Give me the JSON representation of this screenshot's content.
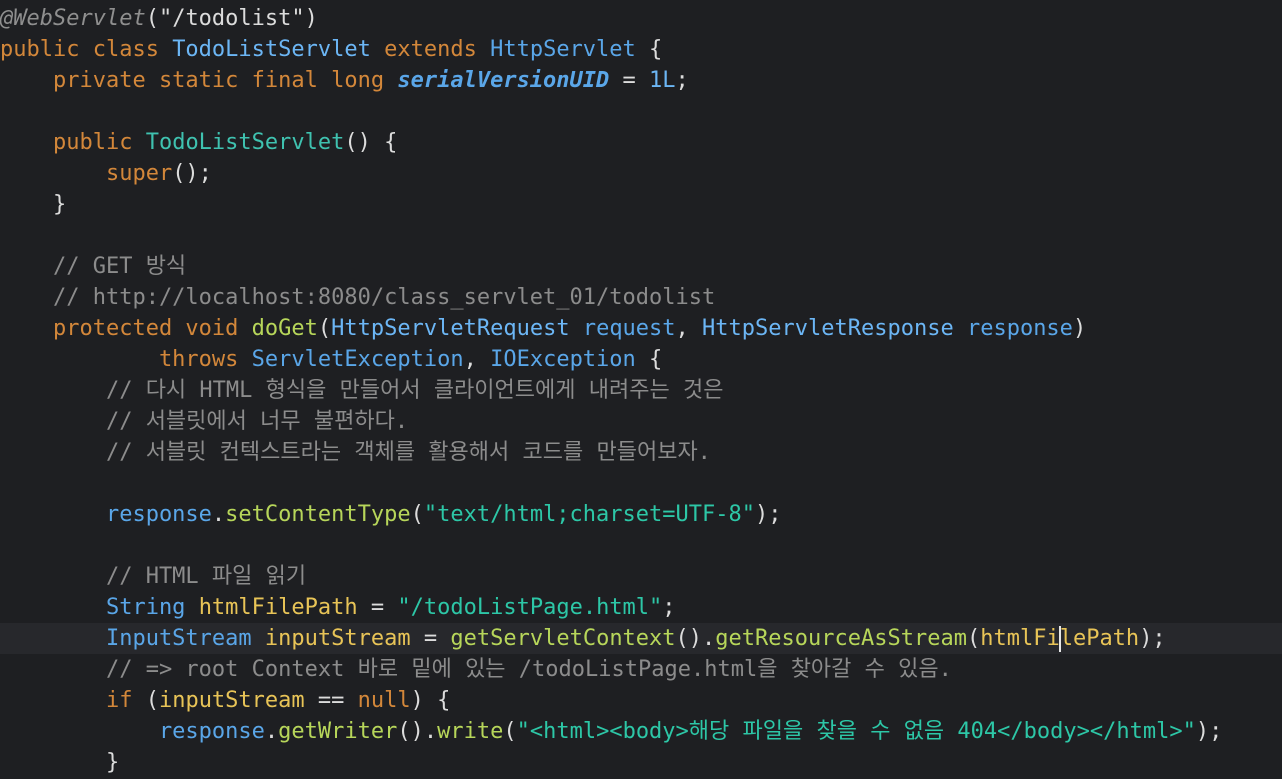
{
  "editor": {
    "caret_line": 20,
    "lines": [
      [
        [
          "@WebServlet",
          "ann"
        ],
        [
          "(\"/todolist\")",
          "def"
        ]
      ],
      [
        [
          "public class ",
          "kw"
        ],
        [
          "TodoListServlet",
          "cls"
        ],
        [
          " extends ",
          "kw"
        ],
        [
          "HttpServlet",
          "type"
        ],
        [
          " {",
          "def"
        ]
      ],
      [
        [
          "    private static final long ",
          "kw"
        ],
        [
          "serialVersionUID",
          "field"
        ],
        [
          " = ",
          "def"
        ],
        [
          "1L",
          "num"
        ],
        [
          ";",
          "def"
        ]
      ],
      [],
      [
        [
          "    public ",
          "kw"
        ],
        [
          "TodoListServlet",
          "ctor"
        ],
        [
          "() {",
          "def"
        ]
      ],
      [
        [
          "        super",
          "kw"
        ],
        [
          "();",
          "def"
        ]
      ],
      [
        [
          "    }",
          "def"
        ]
      ],
      [],
      [
        [
          "    // GET 방식",
          "cmt"
        ]
      ],
      [
        [
          "    // http://localhost:8080/class_servlet_01/todolist",
          "cmt"
        ]
      ],
      [
        [
          "    protected void ",
          "kw"
        ],
        [
          "doGet",
          "fn"
        ],
        [
          "(",
          "def"
        ],
        [
          "HttpServletRequest",
          "cls"
        ],
        [
          " request",
          "type"
        ],
        [
          ", ",
          "def"
        ],
        [
          "HttpServletResponse",
          "cls"
        ],
        [
          " response",
          "type"
        ],
        [
          ")",
          "def"
        ]
      ],
      [
        [
          "            throws ",
          "kw"
        ],
        [
          "ServletException",
          "type"
        ],
        [
          ", ",
          "def"
        ],
        [
          "IOException",
          "type"
        ],
        [
          " {",
          "def"
        ]
      ],
      [
        [
          "        // 다시 HTML 형식을 만들어서 클라이언트에게 내려주는 것은",
          "cmt"
        ]
      ],
      [
        [
          "        // 서블릿에서 너무 불편하다.",
          "cmt"
        ]
      ],
      [
        [
          "        // 서블릿 컨텍스트라는 객체를 활용해서 코드를 만들어보자.",
          "cmt"
        ]
      ],
      [],
      [
        [
          "        response",
          "type"
        ],
        [
          ".",
          "def"
        ],
        [
          "setContentType",
          "fn"
        ],
        [
          "(",
          "def"
        ],
        [
          "\"text/html;charset=UTF-8\"",
          "str"
        ],
        [
          ");",
          "def"
        ]
      ],
      [],
      [
        [
          "        // HTML 파일 읽기",
          "cmt"
        ]
      ],
      [
        [
          "        String",
          "type"
        ],
        [
          " ",
          "def"
        ],
        [
          "htmlFilePath",
          "var"
        ],
        [
          " = ",
          "def"
        ],
        [
          "\"/todoListPage.html\"",
          "str"
        ],
        [
          ";",
          "def"
        ]
      ],
      [
        [
          "        InputStream",
          "type"
        ],
        [
          " ",
          "def"
        ],
        [
          "inputStream",
          "var"
        ],
        [
          " = ",
          "def"
        ],
        [
          "getServletContext",
          "fn"
        ],
        [
          "().",
          "def"
        ],
        [
          "getResourceAsStream",
          "fn"
        ],
        [
          "(",
          "def"
        ],
        [
          "htmlFi",
          "var"
        ],
        [
          "|caret|",
          "caret"
        ],
        [
          "lePath",
          "var"
        ],
        [
          ");",
          "def"
        ]
      ],
      [
        [
          "        // => root Context 바로 밑에 있는 /todoListPage.html을 찾아갈 수 있음.",
          "cmt"
        ]
      ],
      [
        [
          "        if",
          "kw"
        ],
        [
          " (",
          "def"
        ],
        [
          "inputStream",
          "var"
        ],
        [
          " == ",
          "def"
        ],
        [
          "null",
          "kw"
        ],
        [
          ") {",
          "def"
        ]
      ],
      [
        [
          "            response",
          "type"
        ],
        [
          ".",
          "def"
        ],
        [
          "getWriter",
          "fn"
        ],
        [
          "().",
          "def"
        ],
        [
          "write",
          "fn"
        ],
        [
          "(",
          "def"
        ],
        [
          "\"<html><body>해당 파일을 찾을 수 없음 404</body></html>\"",
          "str"
        ],
        [
          ");",
          "def"
        ]
      ],
      [
        [
          "        }",
          "def"
        ]
      ]
    ]
  }
}
